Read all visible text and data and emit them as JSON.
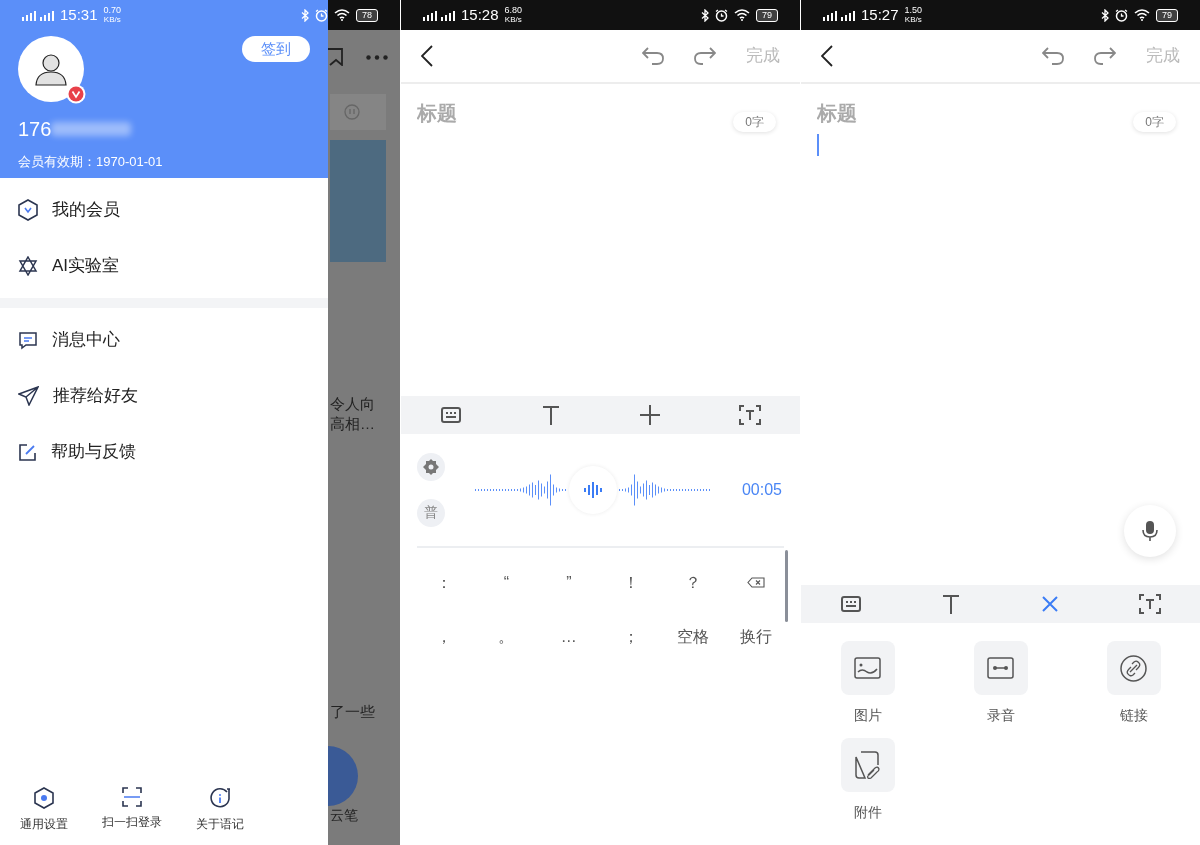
{
  "drawer_screen": {
    "status_bar": {
      "time": "15:31",
      "speed": "0.70",
      "speed_unit": "KB/s",
      "battery": "78"
    },
    "profile": {
      "phone": "176",
      "expiry": "会员有效期：1970-01-01",
      "checkin_button": "签到"
    },
    "menu_sections": [
      [
        {
          "kind": "member",
          "label": "我的会员"
        },
        {
          "kind": "ai",
          "label": "AI实验室"
        }
      ],
      [
        {
          "kind": "message",
          "label": "消息中心"
        },
        {
          "kind": "share",
          "label": "推荐给好友"
        },
        {
          "kind": "feedback",
          "label": "帮助与反馈"
        }
      ]
    ],
    "footer_buttons": [
      {
        "kind": "settings",
        "label": "通用设置"
      },
      {
        "kind": "scan",
        "label": "扫一扫登录"
      },
      {
        "kind": "about",
        "label": "关于语记"
      }
    ],
    "background_texts": [
      "令人向",
      "高相…",
      "了一些",
      "云笔"
    ]
  },
  "voice_screen": {
    "status_bar": {
      "time": "15:28",
      "speed": "6.80",
      "speed_unit": "KB/s",
      "battery": "79"
    },
    "done_button": "完成",
    "title_placeholder": "标题",
    "word_count": "0字",
    "text_cursor": false,
    "toolbar": [
      {
        "kind": "keyboard",
        "active": false
      },
      {
        "kind": "text",
        "active": false
      },
      {
        "kind": "plus",
        "active": false
      },
      {
        "kind": "ocr",
        "active": false
      }
    ],
    "voice_panel": {
      "mode_button": "普",
      "timer": "00:05"
    },
    "keys": [
      {
        "kind": "char",
        "label": "："
      },
      {
        "kind": "char",
        "label": "“"
      },
      {
        "kind": "char",
        "label": "”"
      },
      {
        "kind": "char",
        "label": "！"
      },
      {
        "kind": "char",
        "label": "？"
      },
      {
        "kind": "backspace"
      },
      {
        "kind": "char",
        "label": "，"
      },
      {
        "kind": "char",
        "label": "。"
      },
      {
        "kind": "char",
        "label": "…"
      },
      {
        "kind": "char",
        "label": "；"
      },
      {
        "kind": "char",
        "label": "空格"
      },
      {
        "kind": "char",
        "label": "换行"
      }
    ]
  },
  "attach_screen": {
    "status_bar": {
      "time": "15:27",
      "speed": "1.50",
      "speed_unit": "KB/s",
      "battery": "79"
    },
    "done_button": "完成",
    "title_placeholder": "标题",
    "word_count": "0字",
    "text_cursor": true,
    "toolbar": [
      {
        "kind": "keyboard",
        "active": false
      },
      {
        "kind": "text",
        "active": false
      },
      {
        "kind": "close",
        "active": true
      },
      {
        "kind": "ocr",
        "active": false
      }
    ],
    "attachments": [
      {
        "kind": "image",
        "label": "图片"
      },
      {
        "kind": "audio",
        "label": "录音"
      },
      {
        "kind": "link",
        "label": "链接"
      },
      {
        "kind": "file",
        "label": "附件"
      }
    ]
  }
}
